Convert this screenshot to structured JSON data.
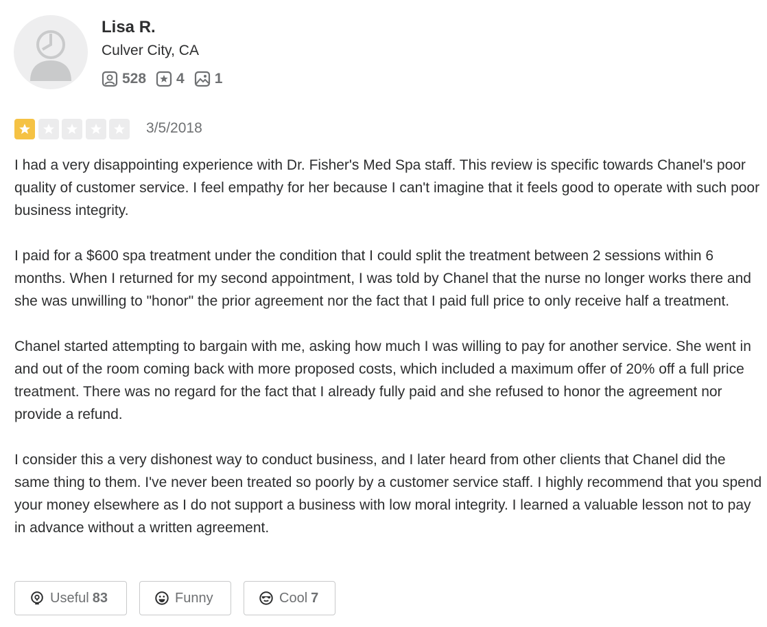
{
  "user": {
    "name": "Lisa R.",
    "location": "Culver City, CA",
    "stats": {
      "friends": "528",
      "reviews": "4",
      "photos": "1"
    }
  },
  "review": {
    "rating": 1,
    "max_rating": 5,
    "date": "3/5/2018",
    "paragraphs": [
      "I had a very disappointing experience with Dr. Fisher's Med Spa staff. This review is specific towards Chanel's poor quality of customer service. I feel empathy for her because I can't imagine that it feels good to operate with such poor business integrity.",
      "I paid for a $600 spa treatment under the condition that I could split the treatment between 2 sessions within 6 months. When I returned for my second appointment, I was told by Chanel that the nurse no longer works there and she was unwilling to \"honor\" the prior agreement nor the fact that I paid full price to only receive half a treatment.",
      "Chanel started attempting to bargain with me, asking how much I was willing to pay for another service. She went in and out of the room coming back with more proposed costs, which included a maximum offer of 20% off a full price treatment. There was no regard for the fact that I already fully paid and she refused to honor the agreement nor provide a refund.",
      "I consider this a very dishonest way to conduct business, and I later heard from other clients that Chanel did the same thing to them. I've never been treated so poorly by a customer service staff. I highly recommend that you spend your money elsewhere as I do not support a business with low moral integrity. I learned a valuable lesson not to pay in advance without a written agreement."
    ]
  },
  "actions": {
    "useful": {
      "label": "Useful",
      "count": "83"
    },
    "funny": {
      "label": "Funny",
      "count": ""
    },
    "cool": {
      "label": "Cool",
      "count": "7"
    }
  },
  "icons": {
    "friends": "friends-icon",
    "reviews": "review-star-icon",
    "photos": "photo-icon",
    "useful": "lightbulb-icon",
    "funny": "smiley-icon",
    "cool": "sunglasses-icon"
  },
  "colors": {
    "star_filled": "#f5c244",
    "star_empty": "#ececed",
    "text": "#2d2e2f",
    "muted": "#6e7072"
  }
}
